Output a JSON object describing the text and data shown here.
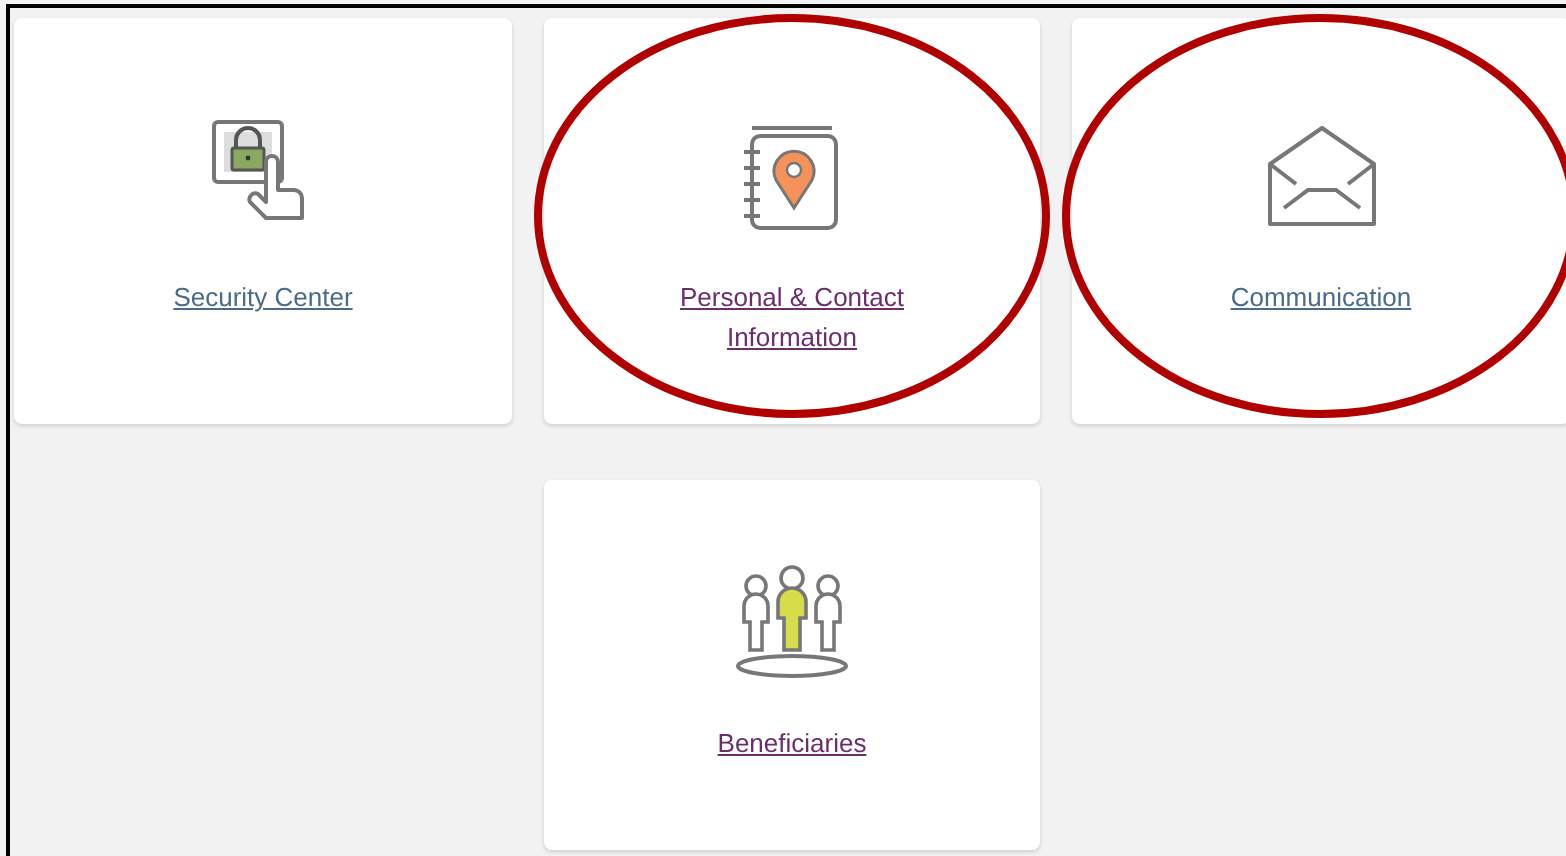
{
  "cards": [
    {
      "kind": "security",
      "label": "Security Center",
      "visited": false,
      "highlighted": false
    },
    {
      "kind": "contact",
      "label": "Personal & Contact Information",
      "visited": true,
      "highlighted": true
    },
    {
      "kind": "mail",
      "label": "Communication",
      "visited": false,
      "highlighted": true
    },
    {
      "kind": "people",
      "label": "Beneficiaries",
      "visited": true,
      "highlighted": false
    }
  ]
}
